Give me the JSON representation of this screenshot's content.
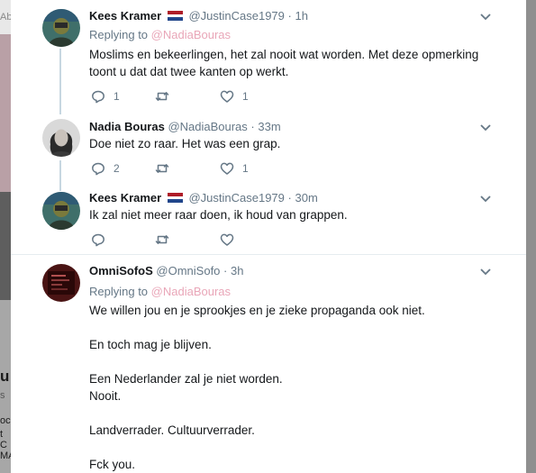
{
  "background": {
    "fragments": [
      "Ab",
      "u",
      "s",
      "oc",
      "t",
      "C",
      "MA"
    ]
  },
  "tweets": [
    {
      "name": "Kees Kramer",
      "handle": "@JustinCase1979",
      "time": "1h",
      "has_flag": true,
      "replying_prefix": "Replying to ",
      "replying_to": "@NadiaBouras",
      "text": "Moslims en bekeerlingen, het zal nooit wat worden. Met deze opmerking\ntoont u dat dat twee kanten op werkt.",
      "reply_count": "1",
      "retweet_count": "",
      "like_count": "1"
    },
    {
      "name": "Nadia Bouras",
      "handle": "@NadiaBouras",
      "time": "33m",
      "has_flag": false,
      "text": "Doe niet zo raar. Het was een grap.",
      "reply_count": "2",
      "retweet_count": "",
      "like_count": "1"
    },
    {
      "name": "Kees Kramer",
      "handle": "@JustinCase1979",
      "time": "30m",
      "has_flag": true,
      "text": "Ik zal niet meer raar doen, ik houd van grappen.",
      "reply_count": "",
      "retweet_count": "",
      "like_count": ""
    },
    {
      "name": "OmniSofoS",
      "handle": "@OmniSofo",
      "time": "3h",
      "has_flag": false,
      "replying_prefix": "Replying to ",
      "replying_to": "@NadiaBouras",
      "text": "We willen jou en je sprookjes en je zieke propaganda ook niet.\n\nEn toch mag je blijven.\n\nEen Nederlander zal je niet worden.\nNooit.\n\nLandverrader. Cultuurverrader.\n\nFck you."
    }
  ],
  "separator_dot": "·",
  "colors": {
    "name": "#14171a",
    "meta": "#657786",
    "mention": "#e9a6b8",
    "thread_line": "#c7d7e1",
    "flag_red": "#ae1c28",
    "flag_white": "#ffffff",
    "flag_blue": "#21468b"
  },
  "icons": [
    "chevron-down-icon",
    "reply-icon",
    "retweet-icon",
    "like-icon",
    "netherlands-flag-icon"
  ]
}
